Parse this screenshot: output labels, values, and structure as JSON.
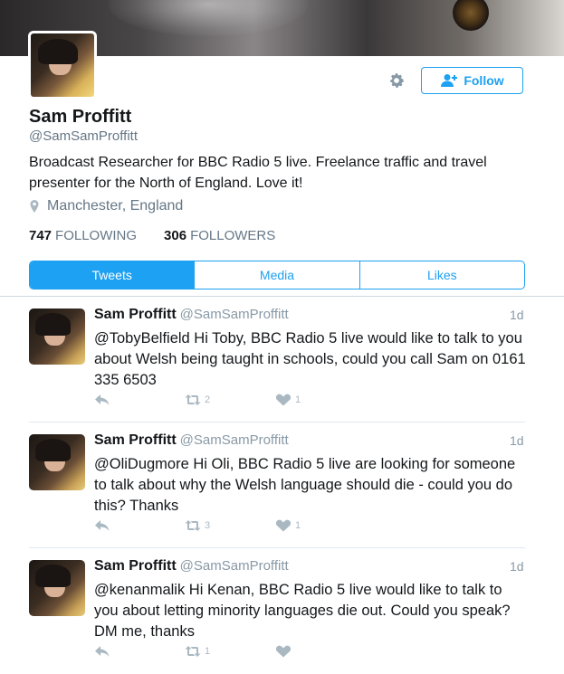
{
  "profile": {
    "name": "Sam Proffitt",
    "handle": "@SamSamProffitt",
    "bio": "Broadcast Researcher for BBC Radio 5 live. Freelance traffic and travel presenter for the North of England. Love it!",
    "location": "Manchester, England",
    "following_count": "747",
    "following_label": "FOLLOWING",
    "followers_count": "306",
    "followers_label": "FOLLOWERS",
    "follow_label": "Follow"
  },
  "tabs": [
    {
      "label": "Tweets",
      "active": true
    },
    {
      "label": "Media",
      "active": false
    },
    {
      "label": "Likes",
      "active": false
    }
  ],
  "tweets": [
    {
      "name": "Sam Proffitt",
      "handle": "@SamSamProffitt",
      "time": "1d",
      "text": "@TobyBelfield Hi Toby, BBC Radio 5 live would like to talk to you about Welsh being taught in schools, could you call Sam on 0161 335 6503",
      "retweets": "2",
      "likes": "1"
    },
    {
      "name": "Sam Proffitt",
      "handle": "@SamSamProffitt",
      "time": "1d",
      "text": "@OliDugmore Hi Oli, BBC Radio 5 live are looking for someone to talk about why the Welsh language should die - could you do this? Thanks",
      "retweets": "3",
      "likes": "1"
    },
    {
      "name": "Sam Proffitt",
      "handle": "@SamSamProffitt",
      "time": "1d",
      "text": "@kenanmalik Hi Kenan, BBC Radio 5 live would like to talk to you about letting minority languages die out. Could you speak? DM me, thanks",
      "retweets": "1",
      "likes": ""
    }
  ],
  "icons": {
    "settings": "gear-icon",
    "follow": "add-user-icon",
    "location": "location-pin-icon",
    "reply": "reply-icon",
    "retweet": "retweet-icon",
    "like": "heart-icon"
  },
  "colors": {
    "accent": "#1da1f2",
    "muted": "#657786",
    "icon": "#aab8c2"
  }
}
